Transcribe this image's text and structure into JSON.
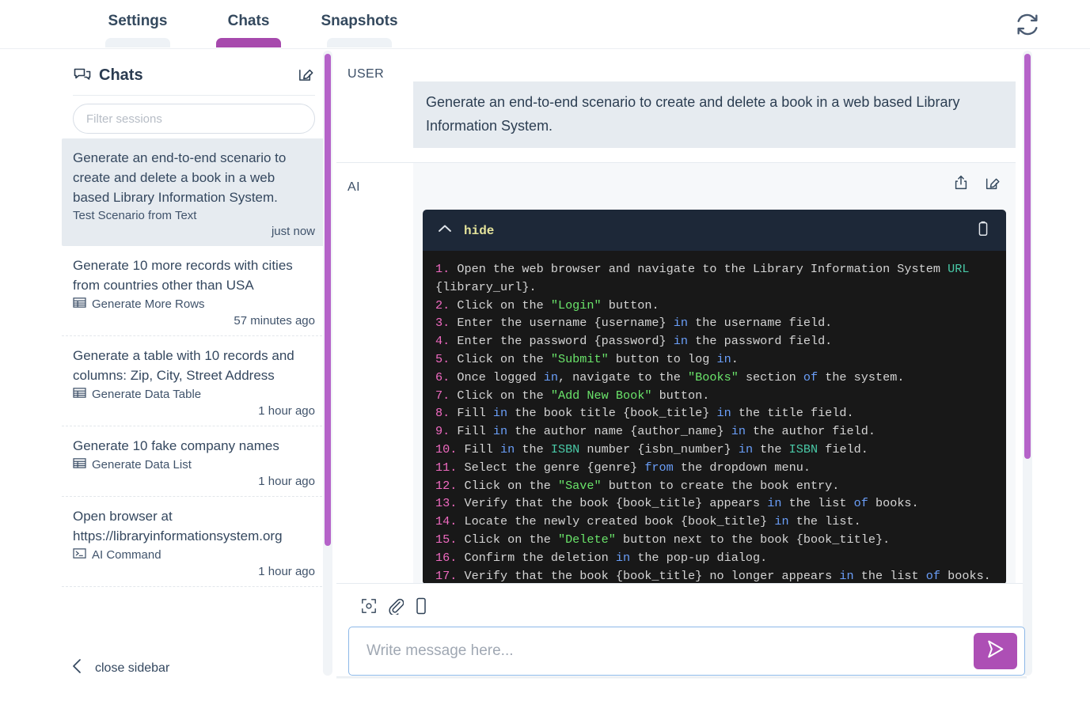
{
  "tabs": [
    {
      "label": "Settings",
      "active": false
    },
    {
      "label": "Chats",
      "active": true
    },
    {
      "label": "Snapshots",
      "active": false
    }
  ],
  "topbar": {
    "refresh_icon": "refresh-sync-icon"
  },
  "sidebar": {
    "title": "Chats",
    "title_icon": "chat-bubbles-icon",
    "new_chat_icon": "compose-edit-icon",
    "filter": {
      "placeholder": "Filter sessions",
      "value": ""
    },
    "close_label": "close sidebar",
    "close_icon": "chevron-left-icon",
    "sessions": [
      {
        "title": "Generate an end-to-end scenario to create and delete a book in a web based Library Information System.",
        "subtitle": "Test Scenario from Text",
        "icon": "",
        "time": "just now",
        "active": true
      },
      {
        "title": "Generate 10 more records with cities from countries other than USA",
        "subtitle": "Generate More Rows",
        "icon": "table-grid-icon",
        "time": "57 minutes ago",
        "active": false
      },
      {
        "title": "Generate a table with 10 records and columns: Zip, City, Street Address",
        "subtitle": "Generate Data Table",
        "icon": "table-grid-icon",
        "time": "1 hour ago",
        "active": false
      },
      {
        "title": "Generate 10 fake company names",
        "subtitle": "Generate Data List",
        "icon": "table-grid-icon",
        "time": "1 hour ago",
        "active": false
      },
      {
        "title": "Open browser at https://libraryinformationsystem.org",
        "subtitle": "AI Command",
        "icon": "terminal-icon",
        "time": "1 hour ago",
        "active": false
      }
    ]
  },
  "conversation": {
    "user": {
      "role_label": "USER",
      "text": "Generate an end-to-end scenario to create and delete a book in a web based Library Information System."
    },
    "ai": {
      "role_label": "AI",
      "share_icon": "share-export-icon",
      "edit_icon": "edit-pencil-icon",
      "code_block": {
        "toggle_label": "hide",
        "toggle_icon": "chevron-up-icon",
        "copy_icon": "clipboard-copy-icon",
        "lines": [
          "1. Open the web browser and navigate to the Library Information System URL {library_url}.",
          "2. Click on the \"Login\" button.",
          "3. Enter the username {username} in the username field.",
          "4. Enter the password {password} in the password field.",
          "5. Click on the \"Submit\" button to log in.",
          "6. Once logged in, navigate to the \"Books\" section of the system.",
          "7. Click on the \"Add New Book\" button.",
          "8. Fill in the book title {book_title} in the title field.",
          "9. Fill in the author name {author_name} in the author field.",
          "10. Fill in the ISBN number {isbn_number} in the ISBN field.",
          "11. Select the genre {genre} from the dropdown menu.",
          "12. Click on the \"Save\" button to create the book entry.",
          "13. Verify that the book {book_title} appears in the list of books.",
          "14. Locate the newly created book {book_title} in the list.",
          "15. Click on the \"Delete\" button next to the book {book_title}.",
          "16. Confirm the deletion in the pop-up dialog.",
          "17. Verify that the book {book_title} no longer appears in the list of books."
        ]
      }
    }
  },
  "composer": {
    "icons": [
      {
        "name": "screenshot-capture-icon"
      },
      {
        "name": "attachment-paperclip-icon"
      },
      {
        "name": "mobile-device-icon"
      }
    ],
    "input": {
      "placeholder": "Write message here...",
      "value": ""
    },
    "send_icon": "send-arrow-icon"
  },
  "colors": {
    "accent_purple": "#ad4fb5",
    "scrollbar_purple": "#b563c9",
    "text_dark": "#2c3e52",
    "bubble_bg": "#e6ebf0",
    "code_header_bg": "#1d2838",
    "code_body_bg": "#181818",
    "code_number": "#f06ac1",
    "code_keyword": "#6a9ef8",
    "code_string": "#6ae46a",
    "code_type": "#49c9a7",
    "input_border_blue": "#8cb8e8"
  }
}
